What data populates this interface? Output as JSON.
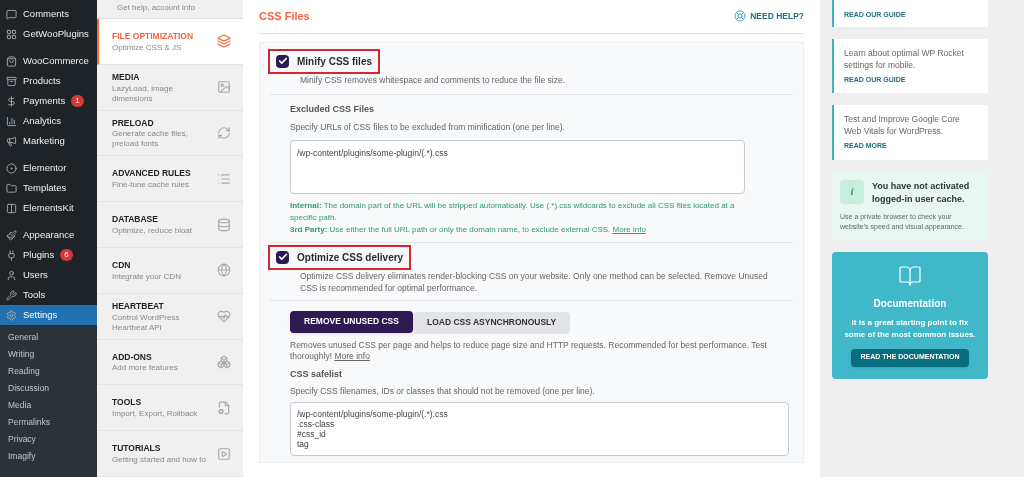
{
  "admin_menu": {
    "items": [
      {
        "label": "Comments",
        "selected": false
      },
      {
        "label": "GetWooPlugins",
        "selected": false
      },
      {
        "label": "WooCommerce",
        "selected": false
      },
      {
        "label": "Products",
        "selected": false
      },
      {
        "label": "Payments",
        "badge": "1",
        "selected": false
      },
      {
        "label": "Analytics",
        "selected": false
      },
      {
        "label": "Marketing",
        "selected": false
      },
      {
        "label": "Elementor",
        "selected": false
      },
      {
        "label": "Templates",
        "selected": false
      },
      {
        "label": "ElementsKit",
        "selected": false
      },
      {
        "label": "Appearance",
        "selected": false
      },
      {
        "label": "Plugins",
        "badge": "6",
        "selected": false
      },
      {
        "label": "Users",
        "selected": false
      },
      {
        "label": "Tools",
        "selected": false
      },
      {
        "label": "Settings",
        "selected": true
      }
    ],
    "submenu": [
      "General",
      "Writing",
      "Reading",
      "Discussion",
      "Media",
      "Permalinks",
      "Privacy",
      "Imagify"
    ]
  },
  "plugin_nav": {
    "top_description": "Get help, account info",
    "items": [
      {
        "title": "FILE OPTIMIZATION",
        "description": "Optimize CSS & JS",
        "selected": true
      },
      {
        "title": "MEDIA",
        "description": "LazyLoad, image dimensions",
        "selected": false
      },
      {
        "title": "PRELOAD",
        "description": "Generate cache files, preload fonts",
        "selected": false
      },
      {
        "title": "ADVANCED RULES",
        "description": "Fine-tune cache rules",
        "selected": false
      },
      {
        "title": "DATABASE",
        "description": "Optimize, reduce bloat",
        "selected": false
      },
      {
        "title": "CDN",
        "description": "Integrate your CDN",
        "selected": false
      },
      {
        "title": "HEARTBEAT",
        "description": "Control WordPress Heartbeat API",
        "selected": false
      },
      {
        "title": "ADD-ONS",
        "description": "Add more features",
        "selected": false
      },
      {
        "title": "TOOLS",
        "description": "Import, Export, Rollback",
        "selected": false
      },
      {
        "title": "TUTORIALS",
        "description": "Getting started and how to",
        "selected": false
      }
    ]
  },
  "section": {
    "title": "CSS Files",
    "help_link": "NEED HELP?"
  },
  "minify": {
    "label": "Minify CSS files",
    "checked": true,
    "highlighted": true,
    "description": "Minify CSS removes whitespace and comments to reduce the file size.",
    "excluded": {
      "label": "Excluded CSS Files",
      "description": "Specify URLs of CSS files to be excluded from minification (one per line).",
      "value": "/wp-content/plugins/some-plugin/(.*).css",
      "notes": [
        "**Internal:** The domain part of the URL will be stripped automatically. Use (.*).css wildcards to exclude all CSS files located at a specific path.",
        "**3rd Party:** Use either the full URL path or only the domain name, to exclude external CSS."
      ],
      "link": "More info"
    }
  },
  "optimize": {
    "label": "Optimize CSS delivery",
    "checked": true,
    "highlighted": true,
    "description": "Optimize CSS delivery eliminates render-blocking CSS on your website. Only one method can be selected. Remove Unused CSS is recommended for optimal performance.",
    "methods": [
      {
        "label": "REMOVE UNUSED CSS",
        "selected": true
      },
      {
        "label": "LOAD CSS ASYNCHRONOUSLY",
        "selected": false
      }
    ],
    "method_description": "Removes unused CSS per page and helps to reduce page size and HTTP requests. Recommended for best performance. Test thoroughly!",
    "method_link": "More info",
    "safelist": {
      "label": "CSS safelist",
      "description": "Specify CSS filenames, IDs or classes that should not be removed (one per line).",
      "value": "/wp-content/plugins/some-plugin/(.*).css\n.css-class\n#css_id\ntag"
    }
  },
  "right_cards": [
    {
      "link": "READ OUR GUIDE"
    },
    {
      "text": "Learn about optimal WP Rocket settings for mobile.",
      "link": "READ OUR GUIDE"
    },
    {
      "text": "Test and Improve Google Core Web Vitals for WordPress.",
      "link": "READ MORE"
    }
  ],
  "notice": {
    "icon": "i",
    "title": "You have not activated logged-in user cache.",
    "text": "Use a private browser to check your website's speed and visual appearance."
  },
  "docs": {
    "title": "Documentation",
    "text": "It is a great starting point to fix some of the most common issues.",
    "button": "READ THE DOCUMENTATION"
  }
}
